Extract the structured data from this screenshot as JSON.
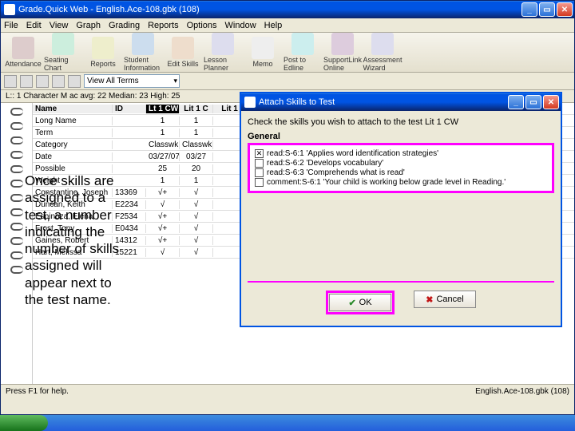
{
  "main_window": {
    "title": "Grade.Quick Web - English.Ace-108.gbk (108)",
    "menu": [
      "File",
      "Edit",
      "View",
      "Graph",
      "Grading",
      "Reports",
      "Options",
      "Window",
      "Help"
    ],
    "toolbar": [
      {
        "label": "Attendance",
        "color": "#dcc"
      },
      {
        "label": "Seating Chart",
        "color": "#ced"
      },
      {
        "label": "Reports",
        "color": "#eec"
      },
      {
        "label": "Student Information",
        "color": "#cde"
      },
      {
        "label": "Edit Skills",
        "color": "#edc"
      },
      {
        "label": "Lesson Planner",
        "color": "#dde"
      },
      {
        "label": "Memo",
        "color": "#eee"
      },
      {
        "label": "Post to Edline",
        "color": "#cee"
      },
      {
        "label": "SupportLink Online",
        "color": "#dcd"
      },
      {
        "label": "Assessment Wizard",
        "color": "#dde"
      }
    ],
    "view_combo": "View All Terms",
    "stats_line": "L:: 1 Character M ac    avg: 22   Median: 23   High: 25",
    "columns": [
      "Name",
      "ID",
      "Lt 1 CW",
      "Lit 1 C",
      "Lit 1"
    ],
    "rows": [
      {
        "label": "Long Name",
        "id": "",
        "v": [
          "1",
          "1",
          ""
        ]
      },
      {
        "label": "Term",
        "id": "",
        "v": [
          "1",
          "1",
          ""
        ]
      },
      {
        "label": "Category",
        "id": "",
        "v": [
          "Classwk",
          "Classwk",
          ""
        ]
      },
      {
        "label": "Date",
        "id": "",
        "v": [
          "03/27/07",
          "03/27",
          ""
        ]
      },
      {
        "label": "Possible",
        "id": "",
        "v": [
          "25",
          "20",
          ""
        ]
      },
      {
        "label": "Weight",
        "id": "",
        "v": [
          "1",
          "1",
          ""
        ]
      },
      {
        "label": "Constantine, Joseph",
        "id": "13369",
        "v": [
          "√+",
          "√",
          ""
        ]
      },
      {
        "label": "Duncan, Keith",
        "id": "E2234",
        "v": [
          "√",
          "√",
          ""
        ]
      },
      {
        "label": "Espinoza, Elena",
        "id": "F2534",
        "v": [
          "√+",
          "√",
          ""
        ]
      },
      {
        "label": "Frost, Tony",
        "id": "E0434",
        "v": [
          "√+",
          "√",
          ""
        ]
      },
      {
        "label": "Gaines, Robert",
        "id": "14312",
        "v": [
          "√+",
          "√",
          ""
        ]
      },
      {
        "label": "Hart, Melissa",
        "id": "15221",
        "v": [
          "√",
          "√",
          ""
        ]
      }
    ],
    "overlay_lines": [
      "Once skills are",
      "assigned to a",
      "test, a number",
      "indicating the",
      "number of skills",
      "assigned will",
      "appear next to",
      "the test name."
    ],
    "status_left": "Press F1 for help.",
    "status_right": "English.Ace-108.gbk (108)"
  },
  "dialog": {
    "title": "Attach Skills to Test",
    "instruction": "Check the skills you wish to attach to the test Lit 1 CW",
    "group_label": "General",
    "skills": [
      {
        "checked": true,
        "text": "read:S-6:1 'Applies word identification strategies'"
      },
      {
        "checked": false,
        "text": "read:S-6:2 'Develops vocabulary'"
      },
      {
        "checked": false,
        "text": "read:S-6:3 'Comprehends what is read'"
      },
      {
        "checked": false,
        "text": "comment:S-6:1 'Your child is working below grade level in Reading.'"
      }
    ],
    "ok_label": "OK",
    "cancel_label": "Cancel"
  }
}
